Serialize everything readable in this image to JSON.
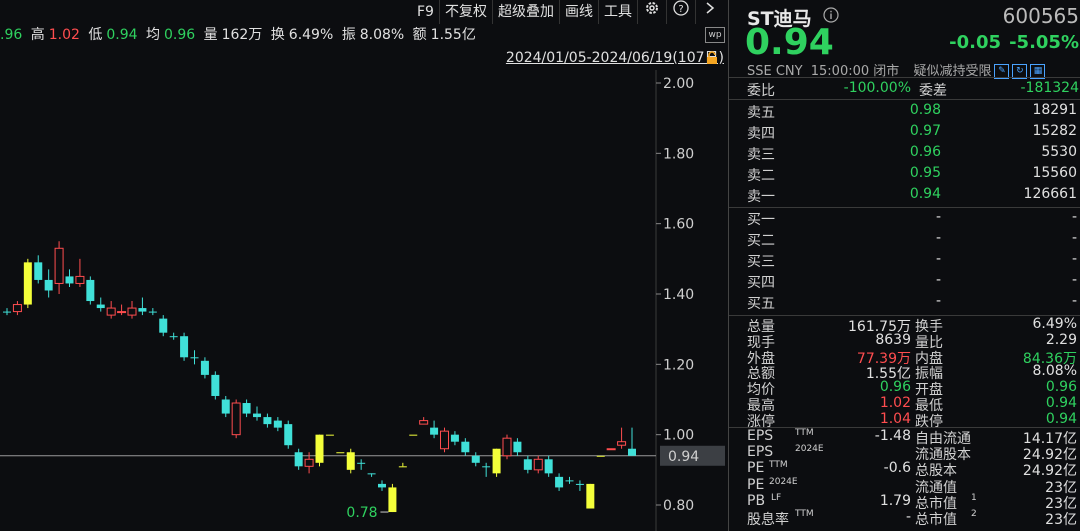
{
  "toolbar": {
    "items": [
      "F9",
      "不复权",
      "超级叠加",
      "画线",
      "工具"
    ],
    "icons": [
      "gear-icon",
      "help-icon",
      "chevron-right-icon"
    ]
  },
  "info": {
    "open_tail": ".96",
    "high_label": "高",
    "high": "1.02",
    "low_label": "低",
    "low": "0.94",
    "avg_label": "均",
    "avg": "0.96",
    "vol_label": "量",
    "vol": "162万",
    "turn_label": "换",
    "turn": "6.49%",
    "amp_label": "振",
    "amp": "8.08%",
    "amt_label": "额",
    "amt": "1.55亿"
  },
  "date_range": "2024/01/05-2024/06/19(107日)",
  "chart_data": {
    "type": "candlestick",
    "y_ticks": [
      "2.00",
      "1.80",
      "1.60",
      "1.40",
      "1.20",
      "1.00",
      "0.80"
    ],
    "ylim": [
      0.72,
      2.02
    ],
    "current_price_label": "0.94",
    "min_label": "0.78",
    "candles": [
      {
        "o": 1.35,
        "c": 1.35,
        "h": 1.36,
        "l": 1.34,
        "up": false
      },
      {
        "o": 1.35,
        "c": 1.37,
        "h": 1.38,
        "l": 1.34,
        "up": true
      },
      {
        "o": 1.37,
        "c": 1.49,
        "h": 1.5,
        "l": 1.36,
        "up": true,
        "limit": true
      },
      {
        "o": 1.49,
        "c": 1.44,
        "h": 1.51,
        "l": 1.43,
        "up": false
      },
      {
        "o": 1.44,
        "c": 1.41,
        "h": 1.47,
        "l": 1.39,
        "up": false
      },
      {
        "o": 1.43,
        "c": 1.53,
        "h": 1.55,
        "l": 1.4,
        "up": true
      },
      {
        "o": 1.45,
        "c": 1.43,
        "h": 1.47,
        "l": 1.42,
        "up": false
      },
      {
        "o": 1.43,
        "c": 1.45,
        "h": 1.5,
        "l": 1.42,
        "up": true
      },
      {
        "o": 1.44,
        "c": 1.38,
        "h": 1.45,
        "l": 1.37,
        "up": false
      },
      {
        "o": 1.37,
        "c": 1.36,
        "h": 1.39,
        "l": 1.35,
        "up": false
      },
      {
        "o": 1.34,
        "c": 1.36,
        "h": 1.38,
        "l": 1.33,
        "up": true
      },
      {
        "o": 1.35,
        "c": 1.35,
        "h": 1.37,
        "l": 1.34,
        "up": true
      },
      {
        "o": 1.34,
        "c": 1.36,
        "h": 1.38,
        "l": 1.33,
        "up": true
      },
      {
        "o": 1.36,
        "c": 1.35,
        "h": 1.39,
        "l": 1.34,
        "up": false
      },
      {
        "o": 1.35,
        "c": 1.35,
        "h": 1.36,
        "l": 1.34,
        "up": false
      },
      {
        "o": 1.33,
        "c": 1.29,
        "h": 1.34,
        "l": 1.28,
        "up": false
      },
      {
        "o": 1.28,
        "c": 1.28,
        "h": 1.29,
        "l": 1.27,
        "up": false
      },
      {
        "o": 1.28,
        "c": 1.22,
        "h": 1.29,
        "l": 1.21,
        "up": false
      },
      {
        "o": 1.22,
        "c": 1.22,
        "h": 1.24,
        "l": 1.2,
        "up": false
      },
      {
        "o": 1.21,
        "c": 1.17,
        "h": 1.22,
        "l": 1.16,
        "up": false
      },
      {
        "o": 1.17,
        "c": 1.11,
        "h": 1.18,
        "l": 1.1,
        "up": false
      },
      {
        "o": 1.1,
        "c": 1.06,
        "h": 1.11,
        "l": 1.05,
        "up": false
      },
      {
        "o": 1.0,
        "c": 1.09,
        "h": 1.1,
        "l": 0.99,
        "up": true
      },
      {
        "o": 1.09,
        "c": 1.06,
        "h": 1.1,
        "l": 1.05,
        "up": false
      },
      {
        "o": 1.06,
        "c": 1.05,
        "h": 1.08,
        "l": 1.04,
        "up": false
      },
      {
        "o": 1.05,
        "c": 1.03,
        "h": 1.06,
        "l": 1.02,
        "up": false
      },
      {
        "o": 1.04,
        "c": 1.02,
        "h": 1.05,
        "l": 1.01,
        "up": false
      },
      {
        "o": 1.03,
        "c": 0.97,
        "h": 1.04,
        "l": 0.96,
        "up": false
      },
      {
        "o": 0.95,
        "c": 0.91,
        "h": 0.96,
        "l": 0.9,
        "up": false
      },
      {
        "o": 0.91,
        "c": 0.93,
        "h": 0.95,
        "l": 0.89,
        "up": true
      },
      {
        "o": 0.92,
        "c": 1.0,
        "h": 1.0,
        "l": 0.91,
        "up": true,
        "limit": true
      },
      {
        "o": 1.0,
        "c": 1.0,
        "h": 1.0,
        "l": 1.0,
        "up": true,
        "limit": true
      },
      {
        "o": 0.95,
        "c": 0.95,
        "h": 0.95,
        "l": 0.95,
        "up": false,
        "limit": true
      },
      {
        "o": 0.95,
        "c": 0.9,
        "h": 0.96,
        "l": 0.89,
        "up": false,
        "limit": true
      },
      {
        "o": 0.92,
        "c": 0.92,
        "h": 0.93,
        "l": 0.9,
        "up": false
      },
      {
        "o": 0.89,
        "c": 0.89,
        "h": 0.89,
        "l": 0.88,
        "up": false
      },
      {
        "o": 0.86,
        "c": 0.85,
        "h": 0.87,
        "l": 0.84,
        "up": false
      },
      {
        "o": 0.85,
        "c": 0.78,
        "h": 0.86,
        "l": 0.78,
        "up": false,
        "limit": true
      },
      {
        "o": 0.91,
        "c": 0.91,
        "h": 0.92,
        "l": 0.91,
        "up": true,
        "limit": true
      },
      {
        "o": 1.0,
        "c": 1.0,
        "h": 1.0,
        "l": 1.0,
        "up": true,
        "limit": true
      },
      {
        "o": 1.03,
        "c": 1.04,
        "h": 1.05,
        "l": 1.03,
        "up": true
      },
      {
        "o": 1.02,
        "c": 1.0,
        "h": 1.04,
        "l": 0.99,
        "up": false
      },
      {
        "o": 0.96,
        "c": 1.01,
        "h": 1.02,
        "l": 0.95,
        "up": true
      },
      {
        "o": 1.0,
        "c": 0.98,
        "h": 1.01,
        "l": 0.97,
        "up": false
      },
      {
        "o": 0.98,
        "c": 0.95,
        "h": 0.99,
        "l": 0.94,
        "up": false
      },
      {
        "o": 0.94,
        "c": 0.92,
        "h": 0.95,
        "l": 0.91,
        "up": false
      },
      {
        "o": 0.91,
        "c": 0.91,
        "h": 0.92,
        "l": 0.88,
        "up": false
      },
      {
        "o": 0.89,
        "c": 0.96,
        "h": 0.96,
        "l": 0.88,
        "up": true,
        "limit": true
      },
      {
        "o": 0.94,
        "c": 0.99,
        "h": 1.0,
        "l": 0.93,
        "up": true
      },
      {
        "o": 0.98,
        "c": 0.95,
        "h": 0.99,
        "l": 0.94,
        "up": false
      },
      {
        "o": 0.93,
        "c": 0.9,
        "h": 0.94,
        "l": 0.89,
        "up": false
      },
      {
        "o": 0.9,
        "c": 0.93,
        "h": 0.94,
        "l": 0.89,
        "up": true
      },
      {
        "o": 0.93,
        "c": 0.89,
        "h": 0.94,
        "l": 0.88,
        "up": false
      },
      {
        "o": 0.88,
        "c": 0.85,
        "h": 0.89,
        "l": 0.84,
        "up": false
      },
      {
        "o": 0.87,
        "c": 0.87,
        "h": 0.88,
        "l": 0.86,
        "up": false
      },
      {
        "o": 0.86,
        "c": 0.86,
        "h": 0.87,
        "l": 0.84,
        "up": false
      },
      {
        "o": 0.86,
        "c": 0.79,
        "h": 0.86,
        "l": 0.79,
        "up": false,
        "limit": true
      },
      {
        "o": 0.94,
        "c": 0.94,
        "h": 0.94,
        "l": 0.94,
        "up": true,
        "limit": true
      },
      {
        "o": 0.96,
        "c": 0.96,
        "h": 0.96,
        "l": 0.96,
        "up": true
      },
      {
        "o": 0.97,
        "c": 0.98,
        "h": 1.02,
        "l": 0.96,
        "up": true
      },
      {
        "o": 0.96,
        "c": 0.94,
        "h": 1.02,
        "l": 0.94,
        "up": false
      }
    ]
  },
  "quote": {
    "name": "ST迪马",
    "code": "600565",
    "price": "0.94",
    "change": "-0.05",
    "change_pct": "-5.05%",
    "exchange": "SSE",
    "currency": "CNY",
    "time": "15:00:00",
    "status": "闭市",
    "notice": "疑似减持受限",
    "colors": {
      "down": "#2fd15f",
      "up": "#ff4d4f",
      "neutral": "#e0e0e0"
    }
  },
  "ratio": {
    "label1": "委比",
    "value1": "-100.00%",
    "label2": "委差",
    "value2": "-181324"
  },
  "asks": [
    {
      "label": "卖五",
      "price": "0.98",
      "vol": "18291"
    },
    {
      "label": "卖四",
      "price": "0.97",
      "vol": "15282"
    },
    {
      "label": "卖三",
      "price": "0.96",
      "vol": "5530"
    },
    {
      "label": "卖二",
      "price": "0.95",
      "vol": "15560"
    },
    {
      "label": "卖一",
      "price": "0.94",
      "vol": "126661"
    }
  ],
  "bids": [
    {
      "label": "买一",
      "price": "-",
      "vol": "-"
    },
    {
      "label": "买二",
      "price": "-",
      "vol": "-"
    },
    {
      "label": "买三",
      "price": "-",
      "vol": "-"
    },
    {
      "label": "买四",
      "price": "-",
      "vol": "-"
    },
    {
      "label": "买五",
      "price": "-",
      "vol": "-"
    }
  ],
  "stats": [
    {
      "l1": "总量",
      "v1": "161.75万",
      "c1": "white",
      "l2": "换手",
      "v2": "6.49%",
      "c2": "white"
    },
    {
      "l1": "现手",
      "v1": "8639",
      "c1": "white",
      "l2": "量比",
      "v2": "2.29",
      "c2": "white"
    },
    {
      "l1": "外盘",
      "v1": "77.39万",
      "c1": "red",
      "l2": "内盘",
      "v2": "84.36万",
      "c2": "green"
    },
    {
      "l1": "总额",
      "v1": "1.55亿",
      "c1": "white",
      "l2": "振幅",
      "v2": "8.08%",
      "c2": "white"
    },
    {
      "l1": "均价",
      "v1": "0.96",
      "c1": "green",
      "l2": "开盘",
      "v2": "0.96",
      "c2": "green"
    },
    {
      "l1": "最高",
      "v1": "1.02",
      "c1": "red",
      "l2": "最低",
      "v2": "0.94",
      "c2": "green"
    },
    {
      "l1": "涨停",
      "v1": "1.04",
      "c1": "red",
      "l2": "跌停",
      "v2": "0.94",
      "c2": "green"
    }
  ],
  "fundamentals": [
    {
      "l1": "EPS",
      "s1": "TTM",
      "v1": "-1.48",
      "l2": "自由流通",
      "s2": "",
      "v2": "14.17亿"
    },
    {
      "l1": "EPS",
      "s1": "2024E",
      "v1": "",
      "l2": "流通股本",
      "s2": "",
      "v2": "24.92亿"
    },
    {
      "l1": "PE",
      "s1": "TTM",
      "v1": "-0.6",
      "l2": "总股本",
      "s2": "",
      "v2": "24.92亿"
    },
    {
      "l1": "PE",
      "s1": "2024E",
      "v1": "",
      "l2": "流通值",
      "s2": "",
      "v2": "23亿"
    },
    {
      "l1": "PB",
      "s1": "LF",
      "v1": "1.79",
      "l2": "总市值",
      "s2": "1",
      "v2": "23亿"
    },
    {
      "l1": "股息率",
      "s1": "TTM",
      "v1": "-",
      "l2": "总市值",
      "s2": "2",
      "v2": "23亿"
    }
  ],
  "collapse_label": "»"
}
